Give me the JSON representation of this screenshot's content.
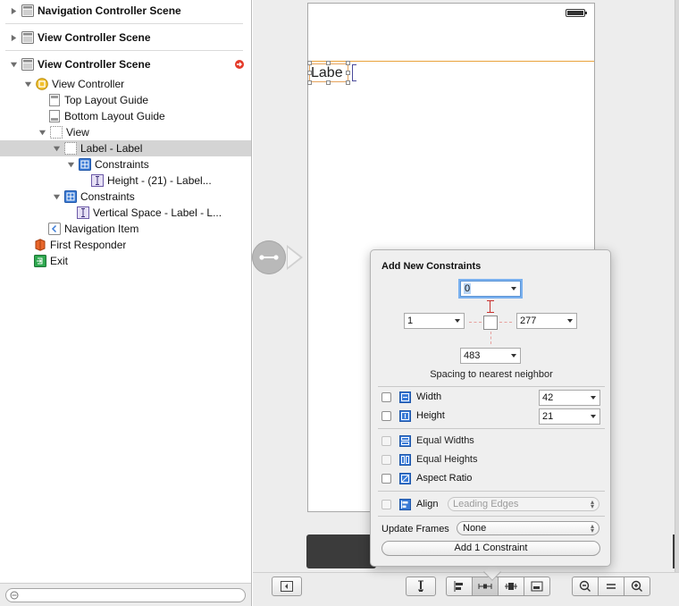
{
  "outline": {
    "scenes": [
      {
        "label": "Navigation Controller Scene",
        "expanded": false
      },
      {
        "label": "View Controller Scene",
        "expanded": false
      },
      {
        "label": "View Controller Scene",
        "expanded": true
      }
    ],
    "items": [
      {
        "label": "View Controller",
        "icon": "view-controller-icon"
      },
      {
        "label": "Top Layout Guide",
        "icon": "layout-guide-icon"
      },
      {
        "label": "Bottom Layout Guide",
        "icon": "layout-guide-icon"
      },
      {
        "label": "View",
        "icon": "view-icon"
      },
      {
        "label": "Label - Label",
        "icon": "label-icon",
        "selected": true
      },
      {
        "label": "Constraints",
        "icon": "constraints-icon"
      },
      {
        "label": "Height - (21) - Label...",
        "icon": "height-constraint-icon"
      },
      {
        "label": "Constraints",
        "icon": "constraints-icon"
      },
      {
        "label": "Vertical Space - Label - L...",
        "icon": "vertical-space-icon"
      },
      {
        "label": "Navigation Item",
        "icon": "navigation-item-icon"
      },
      {
        "label": "First Responder",
        "icon": "first-responder-icon"
      },
      {
        "label": "Exit",
        "icon": "exit-icon"
      }
    ],
    "filter_placeholder": ""
  },
  "canvas": {
    "label_text": "Labe"
  },
  "popover": {
    "title": "Add New Constraints",
    "top_value": "0",
    "left_value": "1",
    "right_value": "277",
    "bottom_value": "483",
    "spacing_caption": "Spacing to nearest neighbor",
    "width_label": "Width",
    "width_value": "42",
    "height_label": "Height",
    "height_value": "21",
    "equal_widths_label": "Equal Widths",
    "equal_heights_label": "Equal Heights",
    "aspect_ratio_label": "Aspect Ratio",
    "align_label": "Align",
    "align_value": "Leading Edges",
    "update_frames_label": "Update Frames",
    "update_frames_value": "None",
    "add_button_label": "Add 1 Constraint"
  },
  "colors": {
    "accent_blue": "#5b94d5",
    "warning_red": "#e43b2a",
    "guide_orange": "#e9a23b"
  }
}
